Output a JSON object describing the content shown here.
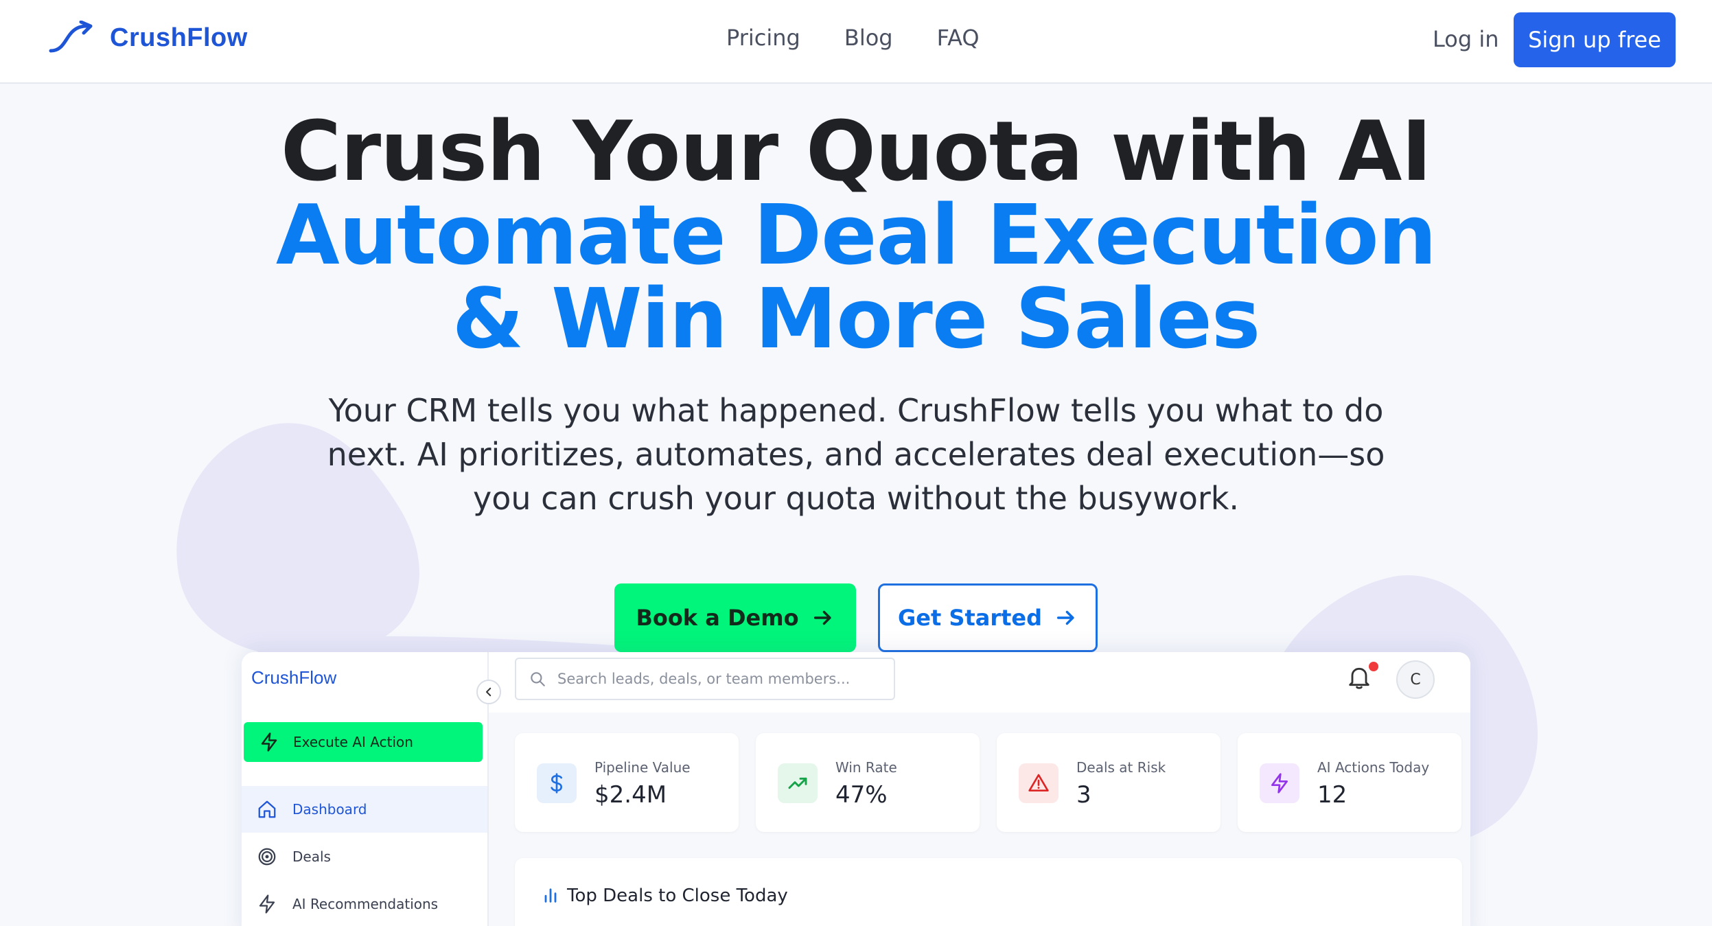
{
  "nav": {
    "brand": "CrushFlow",
    "links": [
      "Pricing",
      "Blog",
      "FAQ"
    ],
    "login": "Log in",
    "signup": "Sign up free"
  },
  "hero": {
    "line1": "Crush Your Quota with AI",
    "line2": "Automate Deal Execution",
    "line3": "& Win More Sales",
    "subtitle": "Your CRM tells you what happened. CrushFlow tells you what to do next. AI prioritizes, automates, and accelerates deal execution—so you can crush your quota without the busywork.",
    "cta_demo": "Book a Demo",
    "cta_start": "Get Started"
  },
  "app": {
    "brand": "CrushFlow",
    "execute_button": "Execute AI Action",
    "sidebar": [
      {
        "label": "Dashboard",
        "icon": "home-icon",
        "active": true
      },
      {
        "label": "Deals",
        "icon": "target-icon",
        "active": false
      },
      {
        "label": "AI Recommendations",
        "icon": "bolt-icon",
        "active": false
      }
    ],
    "search_placeholder": "Search leads, deals, or team members...",
    "avatar_initial": "C",
    "stats": [
      {
        "label": "Pipeline Value",
        "value": "$2.4M",
        "icon": "dollar-icon",
        "color": "#1e6fe0"
      },
      {
        "label": "Win Rate",
        "value": "47%",
        "icon": "trending-up-icon",
        "color": "#16a34a"
      },
      {
        "label": "Deals at Risk",
        "value": "3",
        "icon": "alert-triangle-icon",
        "color": "#dc2626"
      },
      {
        "label": "AI Actions Today",
        "value": "12",
        "icon": "bolt-icon",
        "color": "#9333ea"
      }
    ],
    "deals_title": "Top Deals to Close Today"
  },
  "colors": {
    "brand": "#1e55d6",
    "accent_blue": "#0b7df2",
    "cta_green": "#00f57a",
    "signup_blue": "#2563eb"
  }
}
